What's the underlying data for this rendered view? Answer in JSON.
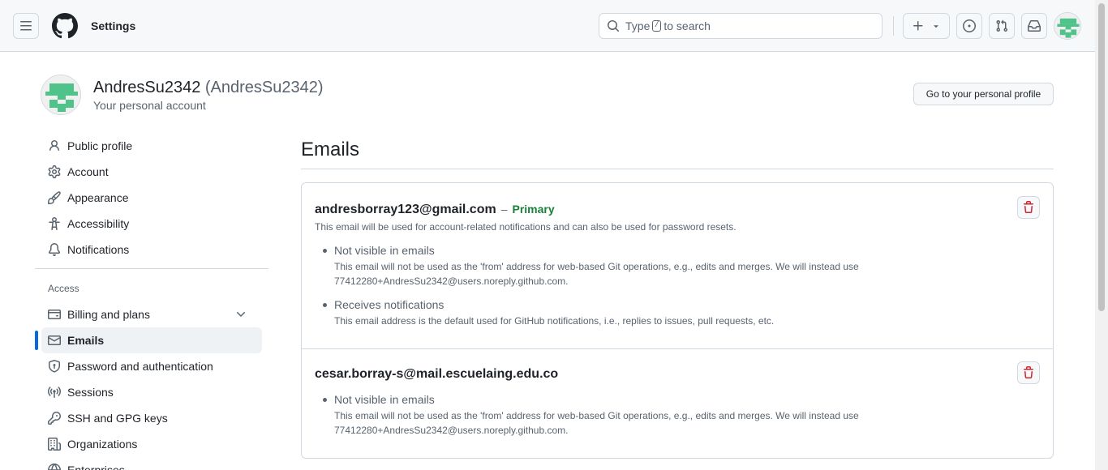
{
  "header": {
    "context_title": "Settings",
    "search": {
      "prefix": "Type",
      "key": "/",
      "suffix": "to search"
    }
  },
  "profile": {
    "display_name": "AndresSu2342",
    "login": "(AndresSu2342)",
    "subtitle": "Your personal account",
    "profile_button": "Go to your personal profile"
  },
  "sidebar": {
    "items_top": [
      {
        "label": "Public profile",
        "icon": "person-icon"
      },
      {
        "label": "Account",
        "icon": "gear-icon"
      },
      {
        "label": "Appearance",
        "icon": "paintbrush-icon"
      },
      {
        "label": "Accessibility",
        "icon": "accessibility-icon"
      },
      {
        "label": "Notifications",
        "icon": "bell-icon"
      }
    ],
    "access_heading": "Access",
    "items_access": [
      {
        "label": "Billing and plans",
        "icon": "credit-card-icon"
      },
      {
        "label": "Emails",
        "icon": "mail-icon"
      },
      {
        "label": "Password and authentication",
        "icon": "shield-lock-icon"
      },
      {
        "label": "Sessions",
        "icon": "broadcast-icon"
      },
      {
        "label": "SSH and GPG keys",
        "icon": "key-icon"
      },
      {
        "label": "Organizations",
        "icon": "organization-icon"
      },
      {
        "label": "Enterprises",
        "icon": "globe-icon"
      }
    ]
  },
  "main": {
    "title": "Emails",
    "emails": [
      {
        "address": "andresborray123@gmail.com",
        "separator": "–",
        "badge": "Primary",
        "note": "This email will be used for account-related notifications and can also be used for password resets.",
        "features": [
          {
            "title": "Not visible in emails",
            "desc_line1": "This email will not be used as the 'from' address for web-based Git operations, e.g., edits and merges. We will instead use",
            "desc_line2": "77412280+AndresSu2342@users.noreply.github.com."
          },
          {
            "title": "Receives notifications",
            "desc_line1": "This email address is the default used for GitHub notifications, i.e., replies to issues, pull requests, etc."
          }
        ]
      },
      {
        "address": "cesar.borray-s@mail.escuelaing.edu.co",
        "features": [
          {
            "title": "Not visible in emails",
            "desc_line1": "This email will not be used as the 'from' address for web-based Git operations, e.g., edits and merges. We will instead use",
            "desc_line2": "77412280+AndresSu2342@users.noreply.github.com."
          }
        ]
      }
    ]
  },
  "colors": {
    "accent": "#0969da",
    "primary_badge": "#1a7f37",
    "danger": "#d1242f",
    "avatar_green": "#4fc38a"
  }
}
